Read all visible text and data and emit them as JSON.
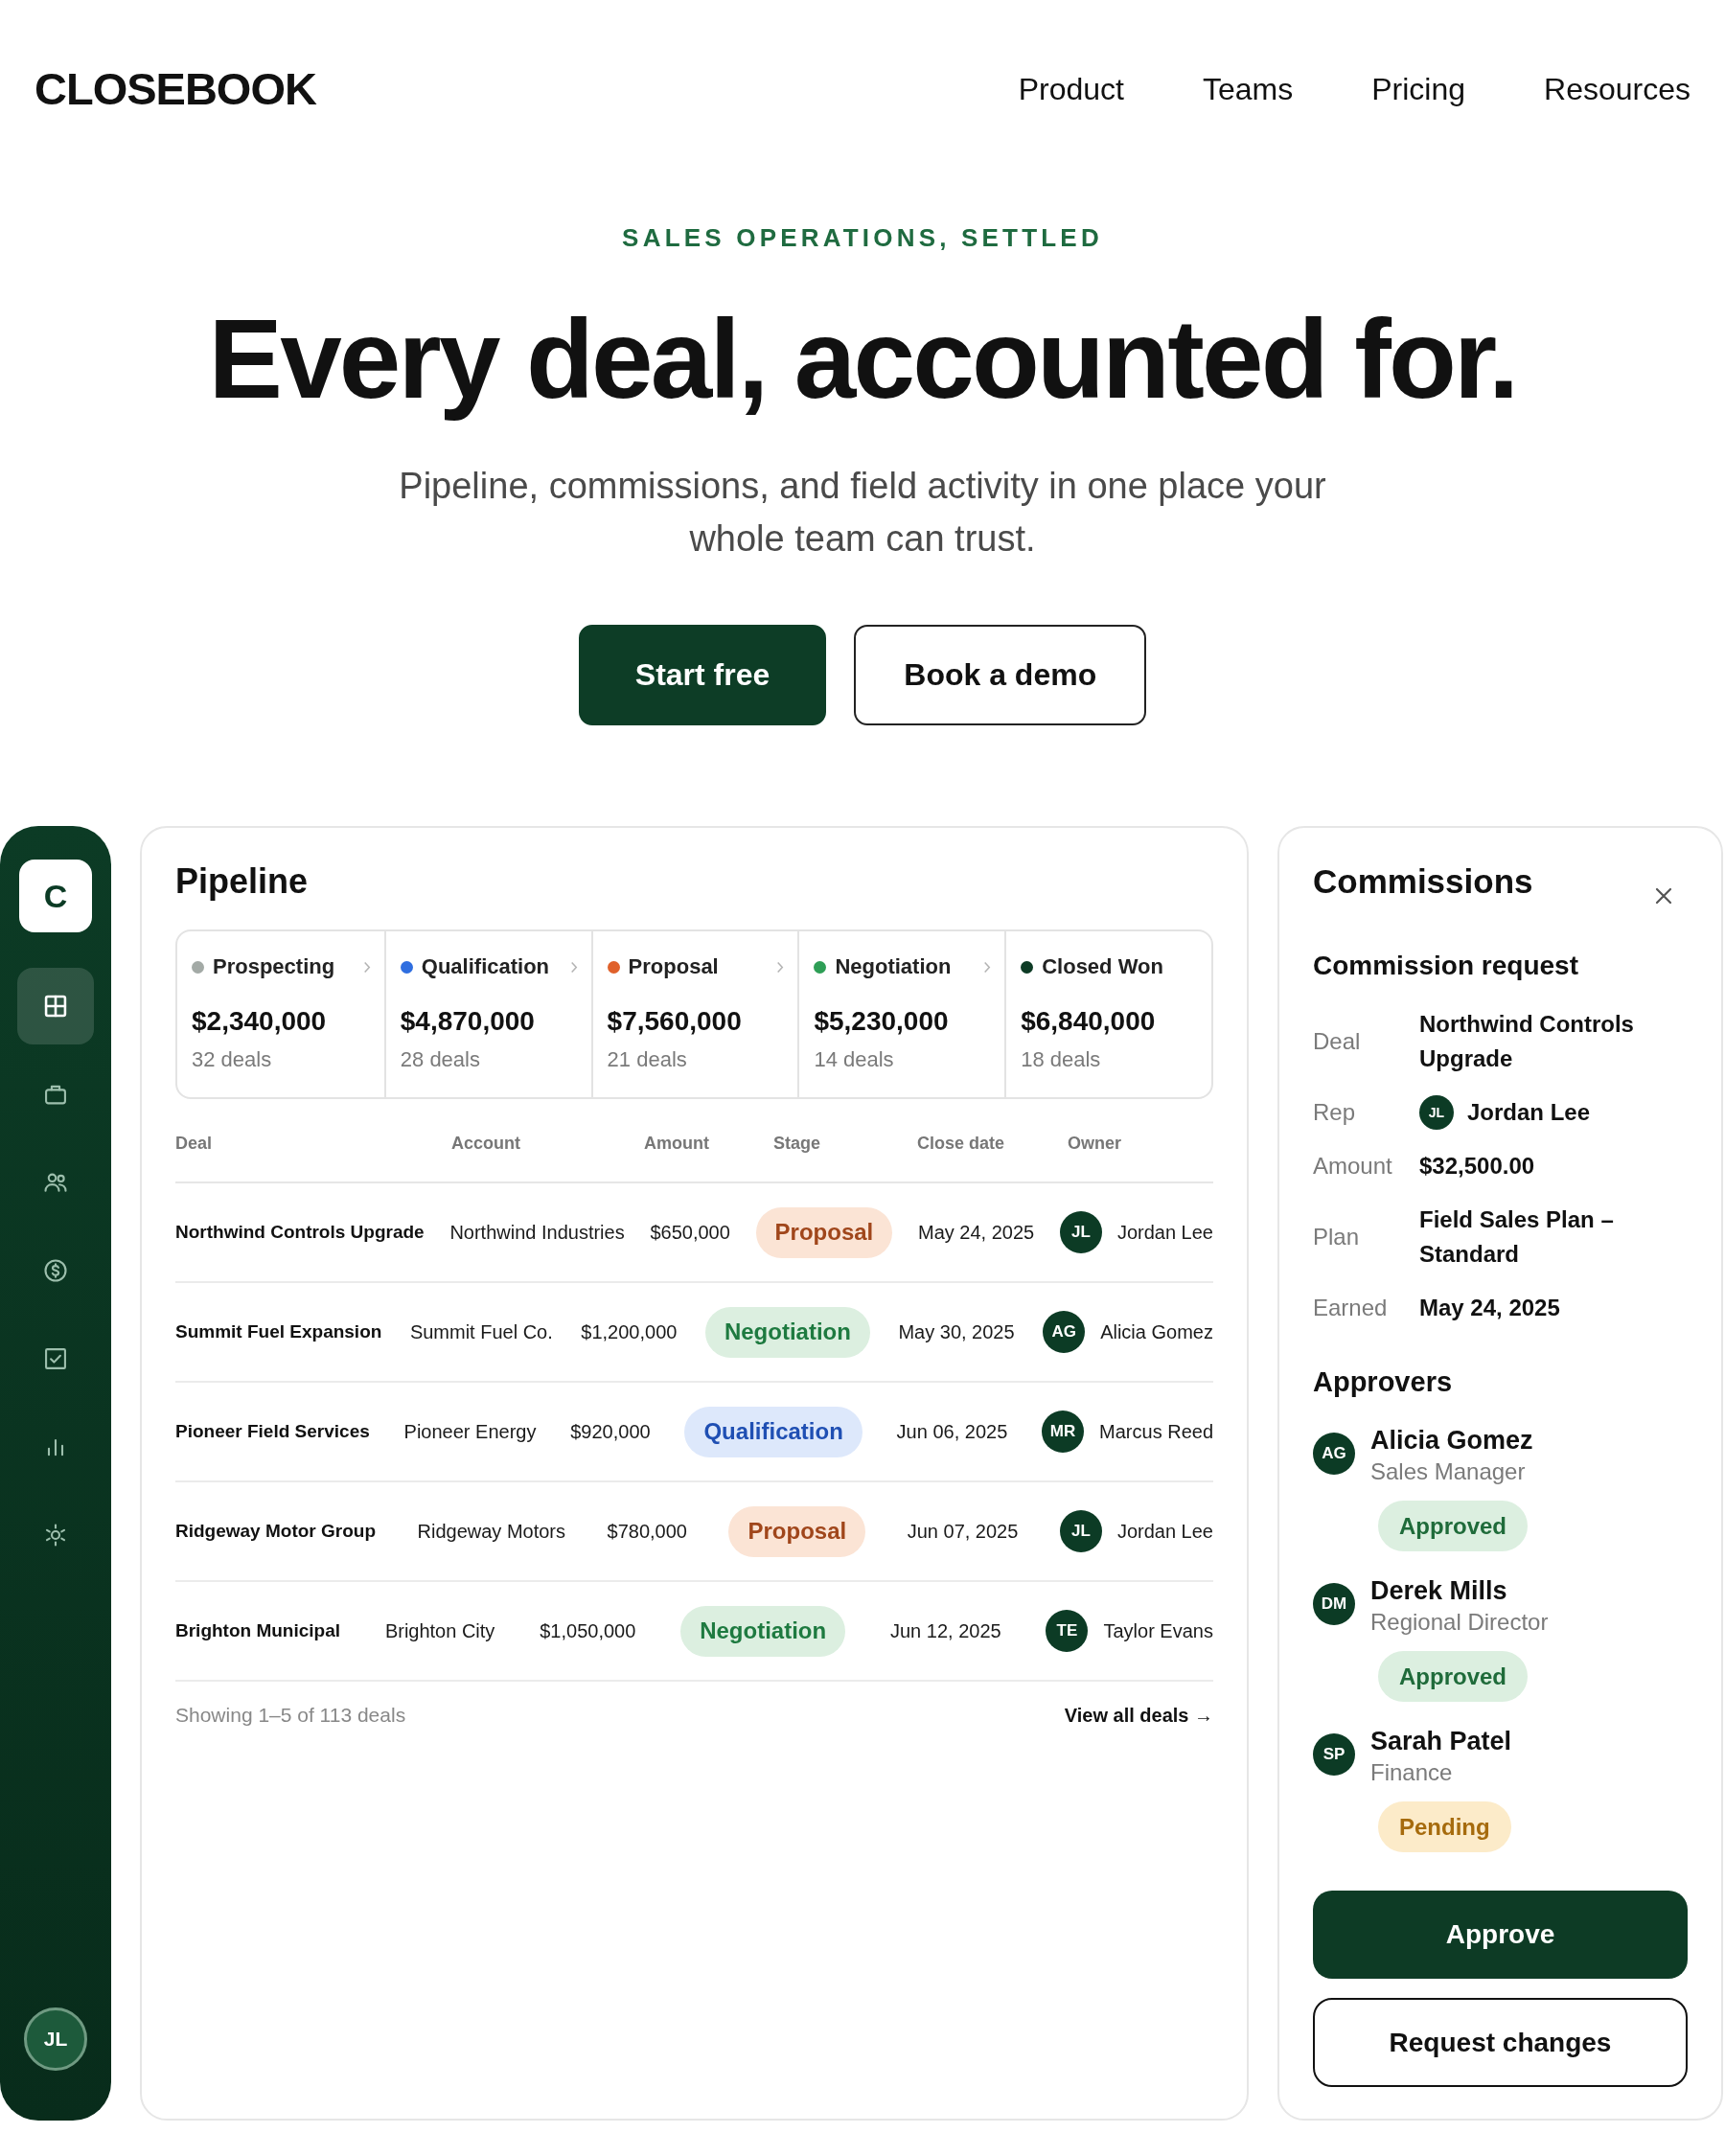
{
  "nav": {
    "logo": "CLOSEBOOK",
    "links": [
      "Product",
      "Teams",
      "Pricing",
      "Resources"
    ]
  },
  "hero": {
    "eyebrow": "SALES OPERATIONS, SETTLED",
    "title": "Every deal, accounted for.",
    "subtitle": "Pipeline, commissions, and field activity in one place your whole team can trust.",
    "buttons": [
      {
        "label": "Start free",
        "kind": "primary"
      },
      {
        "label": "Book a demo",
        "kind": "secondary"
      }
    ]
  },
  "sidebar": {
    "logo": "C",
    "items": [
      {
        "selected": true
      },
      {
        "selected": false
      },
      {
        "selected": false
      },
      {
        "selected": false
      },
      {
        "selected": false
      },
      {
        "selected": false
      },
      {
        "selected": false
      }
    ],
    "user_initials": "JL"
  },
  "pipeline": {
    "title": "Pipeline",
    "stages": [
      {
        "name": "Prospecting",
        "color": "#a3aaa6",
        "amount": "$2,340,000",
        "deals": "32 deals"
      },
      {
        "name": "Qualification",
        "color": "#2f6ee0",
        "amount": "$4,870,000",
        "deals": "28 deals"
      },
      {
        "name": "Proposal",
        "color": "#e0612b",
        "amount": "$7,560,000",
        "deals": "21 deals"
      },
      {
        "name": "Negotiation",
        "color": "#2e9e56",
        "amount": "$5,230,000",
        "deals": "14 deals"
      },
      {
        "name": "Closed Won",
        "color": "#0d3b25",
        "amount": "$6,840,000",
        "deals": "18 deals"
      }
    ],
    "table": {
      "columns": [
        "Deal",
        "Account",
        "Amount",
        "Stage",
        "Close date",
        "Owner"
      ],
      "rows": [
        {
          "deal": "Northwind Controls Upgrade",
          "account": "Northwind Industries",
          "amount": "$650,000",
          "stage": {
            "label": "Proposal",
            "kind": "proposal"
          },
          "close_date": "May 24, 2025",
          "owner": {
            "initials": "JL",
            "name": "Jordan Lee"
          }
        },
        {
          "deal": "Summit Fuel Expansion",
          "account": "Summit Fuel Co.",
          "amount": "$1,200,000",
          "stage": {
            "label": "Negotiation",
            "kind": "negotiation"
          },
          "close_date": "May 30, 2025",
          "owner": {
            "initials": "AG",
            "name": "Alicia Gomez"
          }
        },
        {
          "deal": "Pioneer Field Services",
          "account": "Pioneer Energy",
          "amount": "$920,000",
          "stage": {
            "label": "Qualification",
            "kind": "qualification"
          },
          "close_date": "Jun 06, 2025",
          "owner": {
            "initials": "MR",
            "name": "Marcus Reed"
          }
        },
        {
          "deal": "Ridgeway Motor Group",
          "account": "Ridgeway Motors",
          "amount": "$780,000",
          "stage": {
            "label": "Proposal",
            "kind": "proposal"
          },
          "close_date": "Jun 07, 2025",
          "owner": {
            "initials": "JL",
            "name": "Jordan Lee"
          }
        },
        {
          "deal": "Brighton Municipal",
          "account": "Brighton City",
          "amount": "$1,050,000",
          "stage": {
            "label": "Negotiation",
            "kind": "negotiation"
          },
          "close_date": "Jun 12, 2025",
          "owner": {
            "initials": "TE",
            "name": "Taylor Evans"
          }
        }
      ],
      "footer": "Showing 1–5 of 113 deals",
      "link": "View all deals →"
    }
  },
  "commissions": {
    "title": "Commissions",
    "subtitle": "Commission request",
    "details": [
      {
        "label": "Deal",
        "value": "Northwind Controls Upgrade"
      },
      {
        "label": "Rep",
        "value": "Jordan Lee",
        "initials": "JL"
      },
      {
        "label": "Amount",
        "value": "$32,500.00"
      },
      {
        "label": "Plan",
        "value": "Field Sales Plan – Standard"
      },
      {
        "label": "Earned",
        "value": "May 24, 2025"
      }
    ],
    "approvers_title": "Approvers",
    "approvers": [
      {
        "initials": "AG",
        "name": "Alicia Gomez",
        "role": "Sales Manager",
        "status": {
          "label": "Approved",
          "kind": "approved"
        }
      },
      {
        "initials": "DM",
        "name": "Derek Mills",
        "role": "Regional Director",
        "status": {
          "label": "Approved",
          "kind": "approved"
        }
      },
      {
        "initials": "SP",
        "name": "Sarah Patel",
        "role": "Finance",
        "status": {
          "label": "Pending",
          "kind": "pending"
        }
      }
    ],
    "buttons": [
      {
        "label": "Approve",
        "kind": "primary"
      },
      {
        "label": "Request changes",
        "kind": "secondary"
      }
    ]
  }
}
